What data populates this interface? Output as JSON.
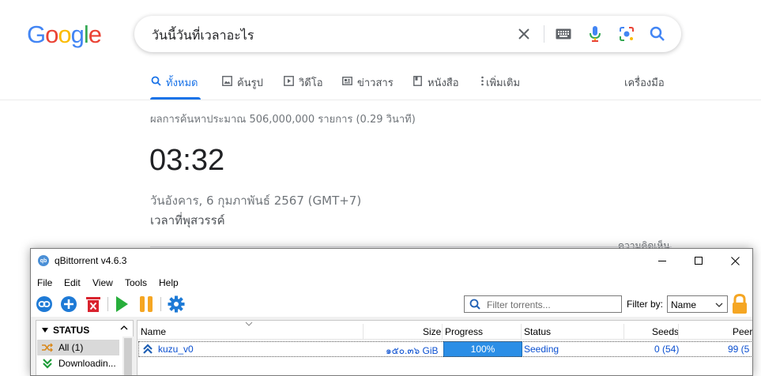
{
  "google": {
    "logo": [
      "G",
      "o",
      "o",
      "g",
      "l",
      "e"
    ],
    "logo_colors": [
      "#4285F4",
      "#EA4335",
      "#FBBC05",
      "#4285F4",
      "#34A853",
      "#EA4335"
    ],
    "search": {
      "query": "วันนี้วันที่เวลาอะไร"
    },
    "tabs": [
      {
        "label": "ทั้งหมด",
        "icon": "search-icon"
      },
      {
        "label": "ค้นรูป",
        "icon": "image-icon"
      },
      {
        "label": "วิดีโอ",
        "icon": "video-icon"
      },
      {
        "label": "ข่าวสาร",
        "icon": "news-icon"
      },
      {
        "label": "หนังสือ",
        "icon": "book-icon"
      },
      {
        "label": "เพิ่มเติม",
        "icon": "more-vertical-icon"
      }
    ],
    "tools_label": "เครื่องมือ",
    "result_stats": "ผลการค้นหาประมาณ 506,000,000 รายการ (0.29 วินาที)",
    "time": "03:32",
    "date": "วันอังคาร, 6 กุมภาพันธ์ 2567 (GMT+7)",
    "timezone": "เวลาที่พุสวรรค์",
    "feedback": "ความคิดเห็น"
  },
  "qbittorrent": {
    "app_icon_text": "qb",
    "title": "qBittorrent v4.6.3",
    "menu": [
      "File",
      "Edit",
      "View",
      "Tools",
      "Help"
    ],
    "filter_placeholder": "Filter torrents...",
    "filter_by_label": "Filter by:",
    "filter_by_value": "Name",
    "sidebar": {
      "header": "STATUS",
      "items": [
        {
          "label": "All (1)",
          "icon": "shuffle-icon"
        },
        {
          "label": "Downloadin...",
          "icon": "download-arrow-icon"
        }
      ]
    },
    "columns": [
      "Name",
      "Size",
      "Progress",
      "Status",
      "Seeds",
      "Peers"
    ],
    "torrents": [
      {
        "name": "kuzu_v0",
        "size": "๑๕๐.๓๖ GiB",
        "progress": "100%",
        "progress_fraction": 1.0,
        "status": "Seeding",
        "seeds": "0 (54)",
        "peers": "99 (5"
      }
    ],
    "colors": {
      "accent": "#2b8ee6",
      "link": "#0a4fd0",
      "pause": "#f5a623",
      "play": "#27ae3b",
      "delete": "#d9232e"
    }
  }
}
